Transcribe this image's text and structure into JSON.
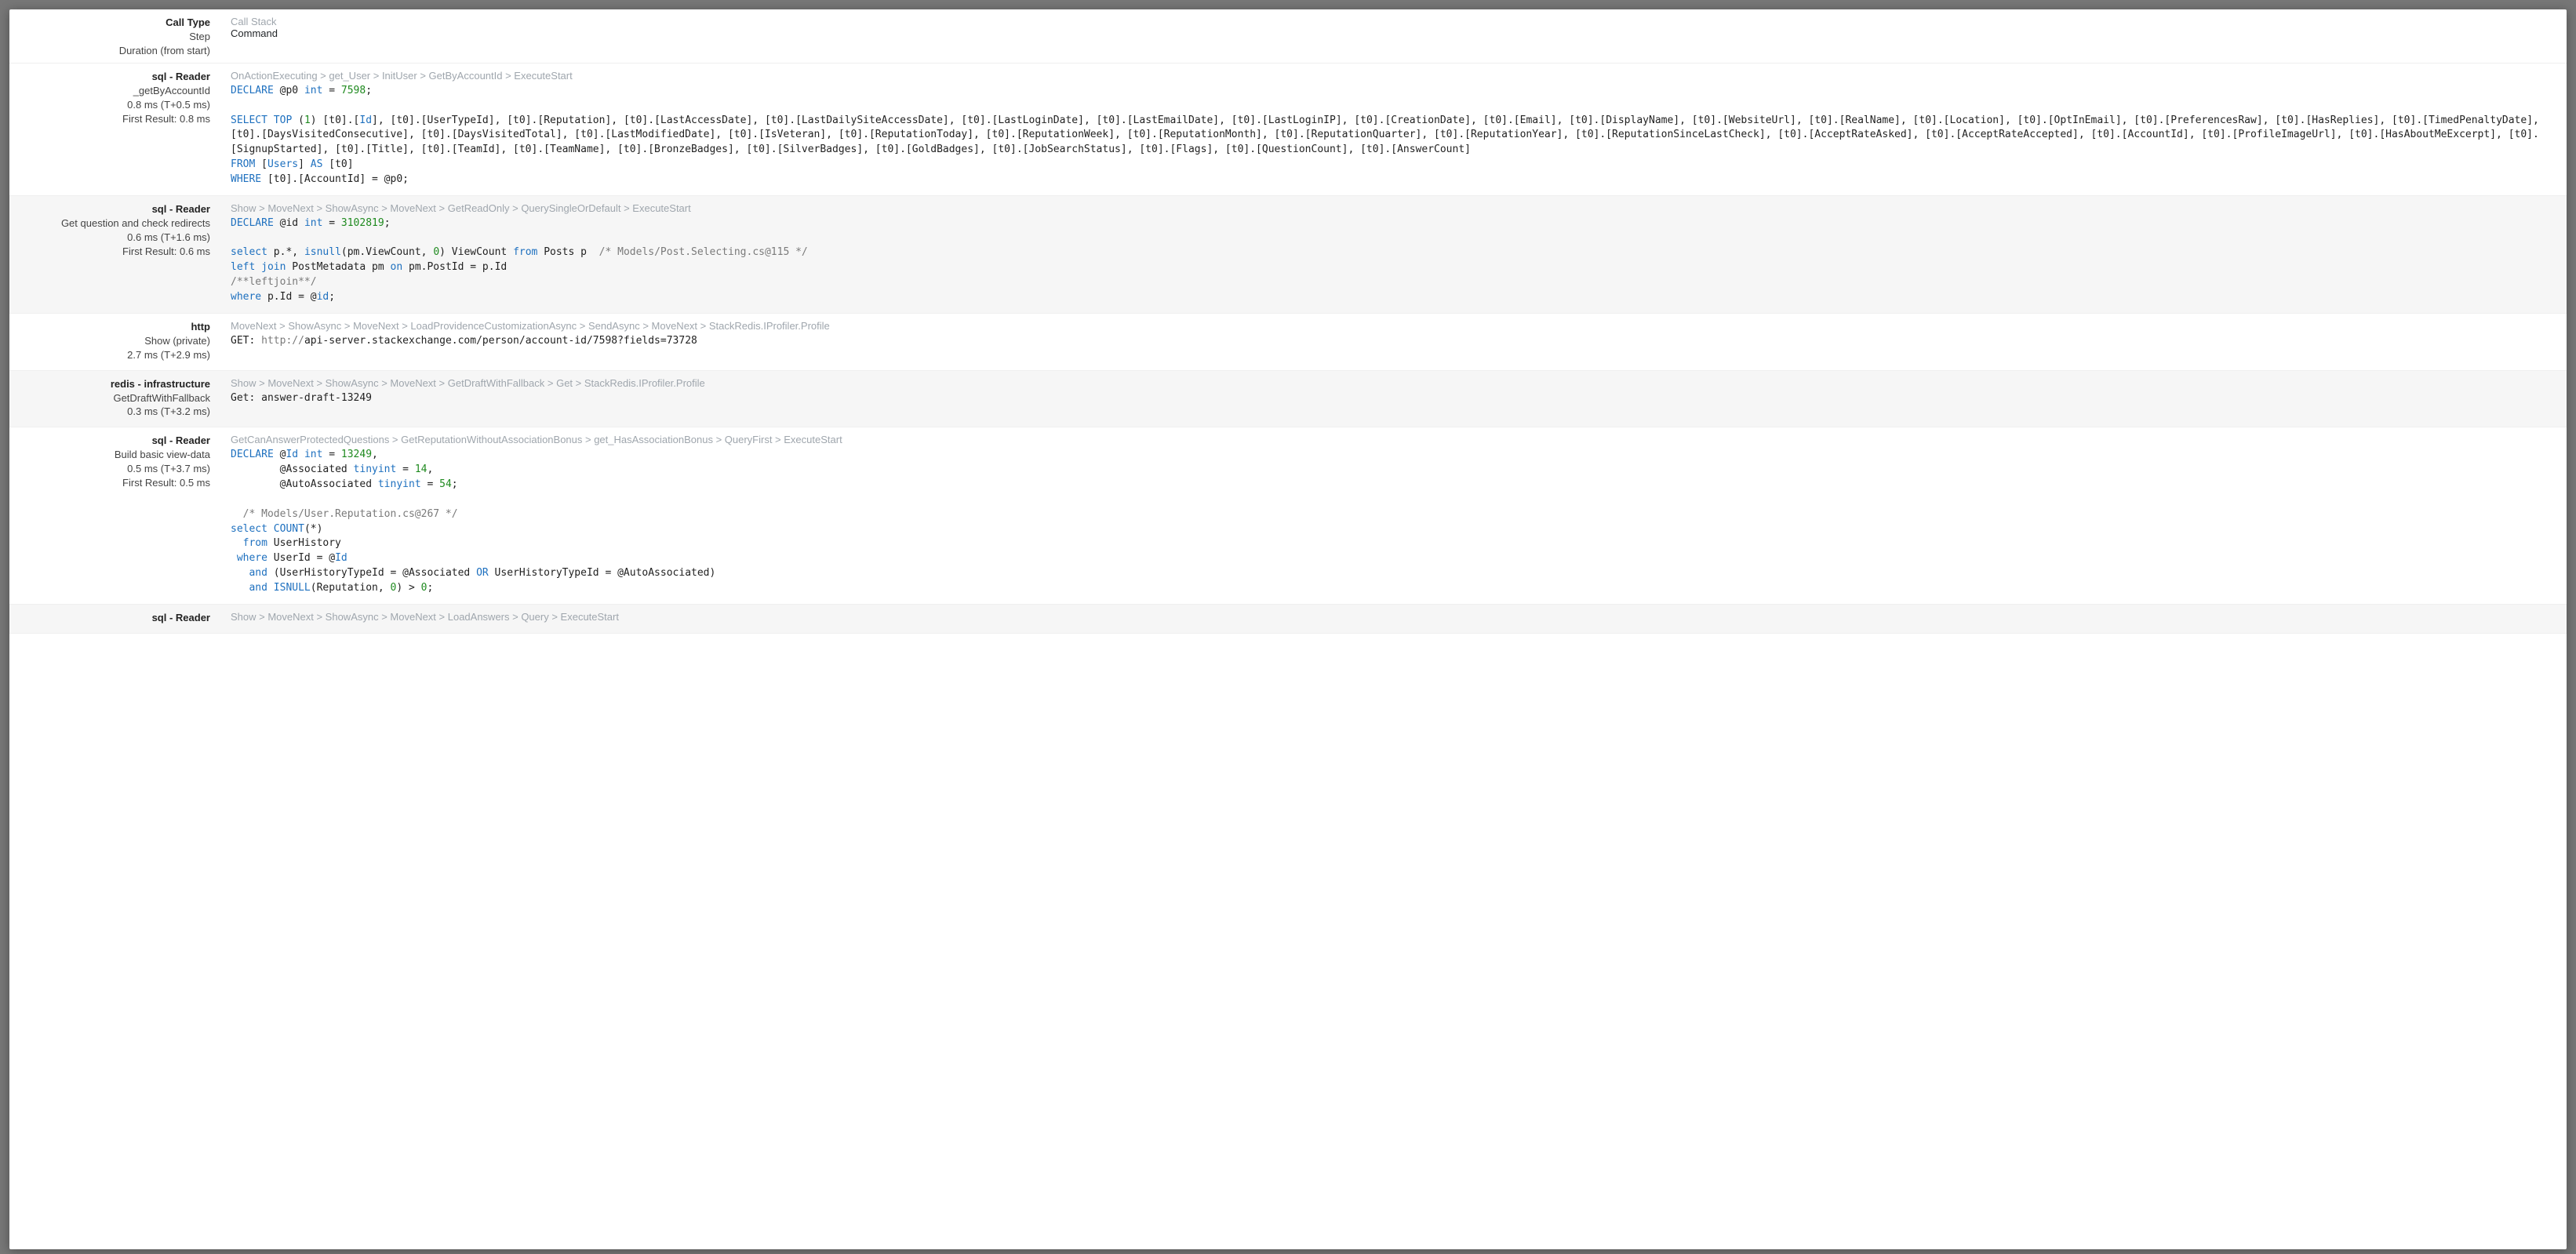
{
  "header": {
    "labels": {
      "callType": "Call Type",
      "step": "Step",
      "duration": "Duration (from start)"
    },
    "values": {
      "callStack": "Call Stack",
      "command": "Command"
    }
  },
  "entries": [
    {
      "shaded": false,
      "title": "sql - Reader",
      "lines": [
        "_getByAccountId",
        "0.8 ms (T+0.5 ms)",
        "First Result: 0.8 ms"
      ],
      "stack": "OnActionExecuting > get_User > InitUser > GetByAccountId > ExecuteStart",
      "codeKey": "sql1"
    },
    {
      "shaded": true,
      "title": "sql - Reader",
      "lines": [
        "Get question and check redirects",
        "0.6 ms (T+1.6 ms)",
        "First Result: 0.6 ms"
      ],
      "stack": "Show > MoveNext > ShowAsync > MoveNext > GetReadOnly > QuerySingleOrDefault > ExecuteStart",
      "codeKey": "sql2"
    },
    {
      "shaded": false,
      "title": "http",
      "lines": [
        "Show (private)",
        "2.7 ms (T+2.9 ms)"
      ],
      "stack": "MoveNext > ShowAsync > MoveNext > LoadProvidenceCustomizationAsync > SendAsync > MoveNext > StackRedis.IProfiler.Profile",
      "codeKey": "http1"
    },
    {
      "shaded": true,
      "title": "redis - infrastructure",
      "lines": [
        "GetDraftWithFallback",
        "0.3 ms (T+3.2 ms)"
      ],
      "stack": "Show > MoveNext > ShowAsync > MoveNext > GetDraftWithFallback > Get > StackRedis.IProfiler.Profile",
      "codeKey": "redis1"
    },
    {
      "shaded": false,
      "title": "sql - Reader",
      "lines": [
        "Build basic view-data",
        "0.5 ms (T+3.7 ms)",
        "First Result: 0.5 ms"
      ],
      "stack": "GetCanAnswerProtectedQuestions > GetReputationWithoutAssociationBonus > get_HasAssociationBonus > QueryFirst > ExecuteStart",
      "codeKey": "sql3"
    },
    {
      "shaded": true,
      "title": "sql - Reader",
      "lines": [],
      "stack": "Show > MoveNext > ShowAsync > MoveNext > LoadAnswers > Query > ExecuteStart",
      "codeKey": ""
    }
  ],
  "code": {
    "sql1": "<span class=\"k\">DECLARE</span> @p0 <span class=\"ty\">int</span> = <span class=\"nm\">7598</span>;\n\n<span class=\"k\">SELECT</span> <span class=\"k\">TOP</span> (<span class=\"nm\">1</span>) [t0].[<span class=\"id\">Id</span>], [t0].[UserTypeId], [t0].[Reputation], [t0].[LastAccessDate], [t0].[LastDailySiteAccessDate], [t0].[LastLoginDate], [t0].[LastEmailDate], [t0].[LastLoginIP], [t0].[CreationDate], [t0].[Email], [t0].[DisplayName], [t0].[WebsiteUrl], [t0].[RealName], [t0].[Location], [t0].[OptInEmail], [t0].[PreferencesRaw], [t0].[HasReplies], [t0].[TimedPenaltyDate], [t0].[DaysVisitedConsecutive], [t0].[DaysVisitedTotal], [t0].[LastModifiedDate], [t0].[IsVeteran], [t0].[ReputationToday], [t0].[ReputationWeek], [t0].[ReputationMonth], [t0].[ReputationQuarter], [t0].[ReputationYear], [t0].[ReputationSinceLastCheck], [t0].[AcceptRateAsked], [t0].[AcceptRateAccepted], [t0].[AccountId], [t0].[ProfileImageUrl], [t0].[HasAboutMeExcerpt], [t0].[SignupStarted], [t0].[Title], [t0].[TeamId], [t0].[TeamName], [t0].[BronzeBadges], [t0].[SilverBadges], [t0].[GoldBadges], [t0].[JobSearchStatus], [t0].[Flags], [t0].[QuestionCount], [t0].[AnswerCount]\n<span class=\"k\">FROM</span> [<span class=\"id\">Users</span>] <span class=\"k\">AS</span> [t0]\n<span class=\"k\">WHERE</span> [t0].[AccountId] = @p0;",
    "sql2": "<span class=\"k\">DECLARE</span> @id <span class=\"ty\">int</span> = <span class=\"nm\">3102819</span>;\n\n<span class=\"k\">select</span> p.*, <span class=\"k\">isnull</span>(pm.ViewCount, <span class=\"nm\">0</span>) ViewCount <span class=\"k\">from</span> Posts p  <span class=\"cm\">/* Models/Post.Selecting.cs@115 */</span>\n<span class=\"k\">left join</span> PostMetadata pm <span class=\"k\">on</span> pm.PostId = p.Id\n<span class=\"cm\">/**leftjoin**/</span>\n<span class=\"k\">where</span> p.Id = @<span class=\"id\">id</span>;",
    "http1": "GET: <span class=\"pl\">http://</span>api-server.stackexchange.com/person/account-id/7598?fields=73728",
    "redis1": "Get: answer-draft-13249",
    "sql3": "<span class=\"k\">DECLARE</span> @<span class=\"id\">Id</span> <span class=\"ty\">int</span> = <span class=\"nm\">13249</span>,\n        @Associated <span class=\"ty\">tinyint</span> = <span class=\"nm\">14</span>,\n        @AutoAssociated <span class=\"ty\">tinyint</span> = <span class=\"nm\">54</span>;\n\n  <span class=\"cm\">/* Models/User.Reputation.cs@267 */</span>\n<span class=\"k\">select</span> <span class=\"k\">COUNT</span>(*)\n  <span class=\"k\">from</span> UserHistory\n <span class=\"k\">where</span> UserId = @<span class=\"id\">Id</span>\n   <span class=\"k\">and</span> (UserHistoryTypeId = @Associated <span class=\"k\">OR</span> UserHistoryTypeId = @AutoAssociated)\n   <span class=\"k\">and</span> <span class=\"k\">ISNULL</span>(Reputation, <span class=\"nm\">0</span>) &gt; <span class=\"nm\">0</span>;"
  }
}
